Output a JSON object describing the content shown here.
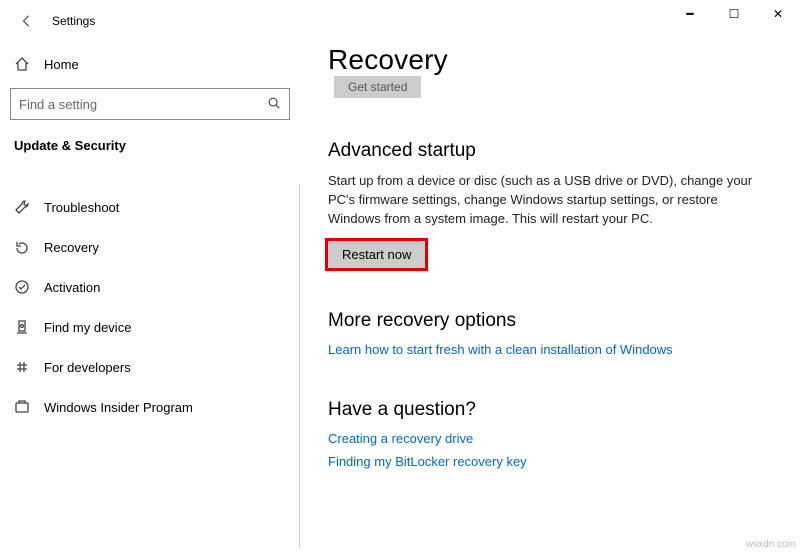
{
  "window": {
    "title": "Settings",
    "minimize_glyph": "━",
    "maximize_glyph": "☐",
    "close_glyph": "✕"
  },
  "sidebar": {
    "home_label": "Home",
    "search_placeholder": "Find a setting",
    "category_label": "Update & Security",
    "items": [
      {
        "label": "Troubleshoot"
      },
      {
        "label": "Recovery"
      },
      {
        "label": "Activation"
      },
      {
        "label": "Find my device"
      },
      {
        "label": "For developers"
      },
      {
        "label": "Windows Insider Program"
      }
    ]
  },
  "main": {
    "title": "Recovery",
    "ghost_button": "Get started",
    "advanced": {
      "heading": "Advanced startup",
      "body": "Start up from a device or disc (such as a USB drive or DVD), change your PC's firmware settings, change Windows startup settings, or restore Windows from a system image. This will restart your PC.",
      "button": "Restart now"
    },
    "more": {
      "heading": "More recovery options",
      "link": "Learn how to start fresh with a clean installation of Windows"
    },
    "question": {
      "heading": "Have a question?",
      "links": [
        "Creating a recovery drive",
        "Finding my BitLocker recovery key"
      ]
    }
  },
  "watermark": "wsxdn.com"
}
